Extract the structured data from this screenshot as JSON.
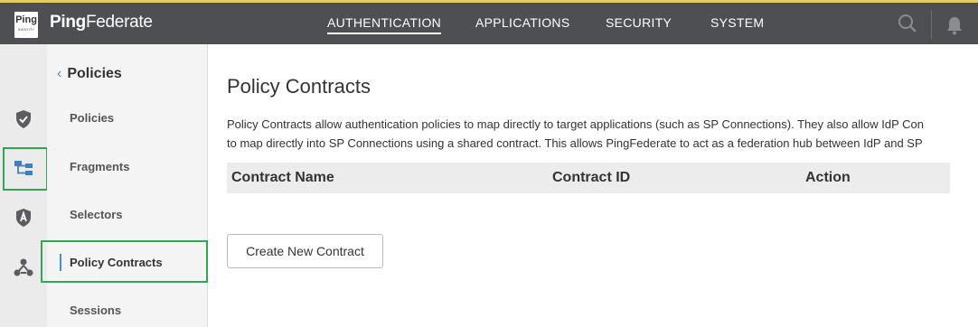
{
  "app": {
    "logo_text": "Ping",
    "logo_sub": "IDENTITY",
    "brand_bold": "Ping",
    "brand_light": "Federate"
  },
  "topnav": {
    "items": [
      {
        "label": "AUTHENTICATION",
        "active": true
      },
      {
        "label": "APPLICATIONS",
        "active": false
      },
      {
        "label": "SECURITY",
        "active": false
      },
      {
        "label": "SYSTEM",
        "active": false
      }
    ]
  },
  "icons": {
    "search": "search-icon",
    "bell": "bell-icon",
    "rail": [
      "shield-check-icon",
      "policy-tree-icon",
      "selector-badge-icon",
      "contracts-icon"
    ]
  },
  "sidebar": {
    "back_label": "Policies",
    "items": [
      {
        "label": "Policies"
      },
      {
        "label": "Fragments"
      },
      {
        "label": "Selectors"
      },
      {
        "label": "Policy Contracts",
        "active": true
      },
      {
        "label": "Sessions"
      }
    ]
  },
  "main": {
    "title": "Policy Contracts",
    "description_line1": "Policy Contracts allow authentication policies to map directly to target applications (such as SP Connections). They also allow IdP Con",
    "description_line2": "to map directly into SP Connections using a shared contract. This allows PingFederate to act as a federation hub between IdP and SP",
    "table": {
      "columns": [
        "Contract Name",
        "Contract ID",
        "Action"
      ]
    },
    "create_button": "Create New Contract"
  },
  "colors": {
    "topbar": "#4d4f53",
    "accent": "#4a8fd1",
    "highlight": "#2fa84f",
    "icon": "#5a5c60"
  }
}
